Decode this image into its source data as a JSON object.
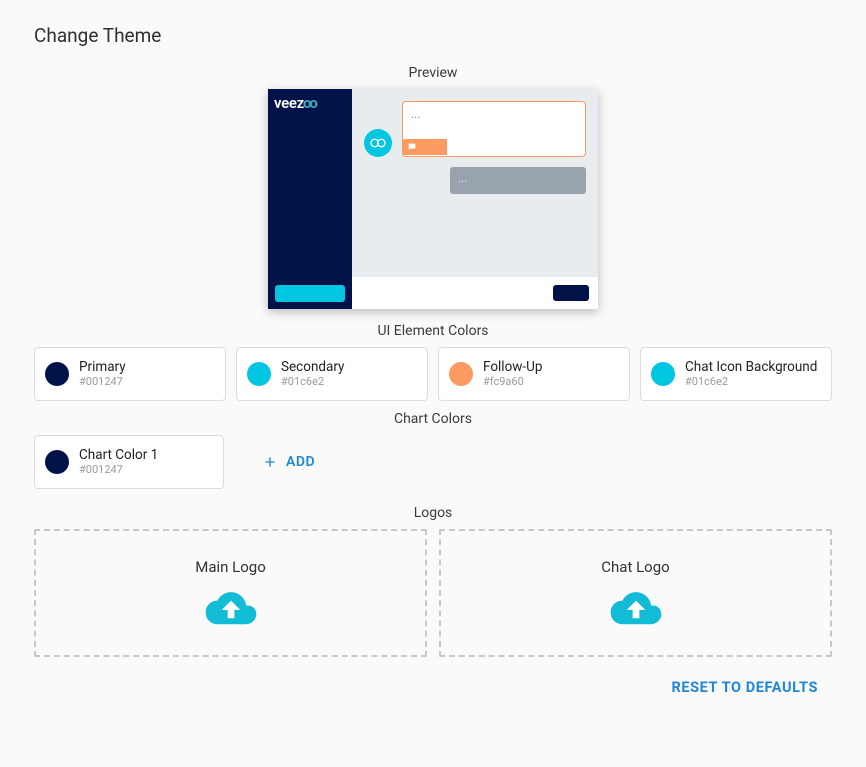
{
  "page": {
    "title": "Change Theme"
  },
  "sections": {
    "preview": "Preview",
    "ui_colors": "UI Element Colors",
    "chart_colors": "Chart Colors",
    "logos": "Logos"
  },
  "preview": {
    "brand_text": "veez",
    "brand_text_accent": "oo",
    "bubble_text": "...",
    "grey_pill_text": "..."
  },
  "ui_colors": [
    {
      "name": "Primary",
      "hex": "#001247"
    },
    {
      "name": "Secondary",
      "hex": "#01c6e2"
    },
    {
      "name": "Follow-Up",
      "hex": "#fc9a60"
    },
    {
      "name": "Chat Icon Background",
      "hex": "#01c6e2"
    }
  ],
  "chart_colors": [
    {
      "name": "Chart Color 1",
      "hex": "#001247"
    }
  ],
  "actions": {
    "add": "ADD",
    "reset": "RESET TO DEFAULTS"
  },
  "logos": {
    "main": "Main Logo",
    "chat": "Chat Logo"
  }
}
